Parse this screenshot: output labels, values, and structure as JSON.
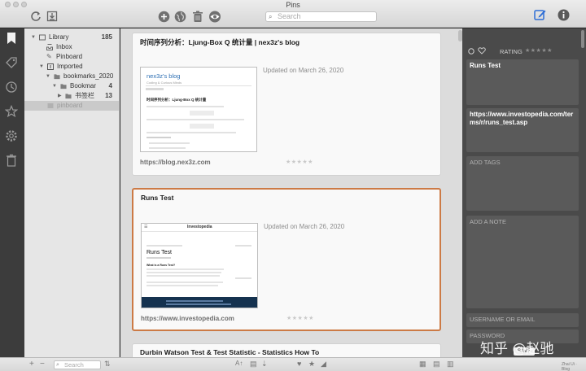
{
  "window": {
    "title": "Pins"
  },
  "toolbar": {
    "search_placeholder": "Search"
  },
  "sources": [
    {
      "label": "Library",
      "count": "185"
    },
    {
      "label": "Inbox",
      "count": ""
    },
    {
      "label": "Pinboard",
      "count": ""
    },
    {
      "label": "Imported",
      "count": ""
    },
    {
      "label": "bookmarks_2020",
      "count": ""
    },
    {
      "label": "Bookmar",
      "count": "4"
    },
    {
      "label": "书签栏",
      "count": "13"
    },
    {
      "label": "pinboard",
      "count": ""
    }
  ],
  "cards": [
    {
      "title": "时间序列分析：Ljung-Box Q 统计量 | nex3z's blog",
      "date": "Updated on  March 26, 2020",
      "url": "https://blog.nex3z.com",
      "thumb_heading": "nex3z's blog",
      "thumb_sub": "Coding & Curious Minds",
      "thumb_post_title": "时间序列分析：Ljung-Box Q 统计量"
    },
    {
      "title": "Runs Test",
      "date": "Updated on  March 26, 2020",
      "url": "https://www.investopedia.com",
      "thumb_heading": "Runs Test",
      "thumb_brand": "Investopedia",
      "thumb_sub": "What is a Runs Test?"
    },
    {
      "title": "Durbin Watson Test & Test Statistic - Statistics How To"
    }
  ],
  "inspector": {
    "rating_label": "RATING",
    "title_value": "Runs Test",
    "url_value": "https://www.investopedia.com/terms/r/runs_test.asp",
    "tags_placeholder": "ADD TAGS",
    "note_placeholder": "ADD A NOTE",
    "username_placeholder": "USERNAME OR EMAIL",
    "password_placeholder": "PASSWORD",
    "save_label": "SAVE"
  },
  "statusbar": {
    "search_placeholder": "Search",
    "right_text": "Zhai Ui · Blog"
  },
  "watermark": "知乎 @赵驰",
  "colors": {
    "accent": "#cc7a45",
    "inspector_bg": "#4a4a4a",
    "rail_bg": "#3c3c3c"
  }
}
